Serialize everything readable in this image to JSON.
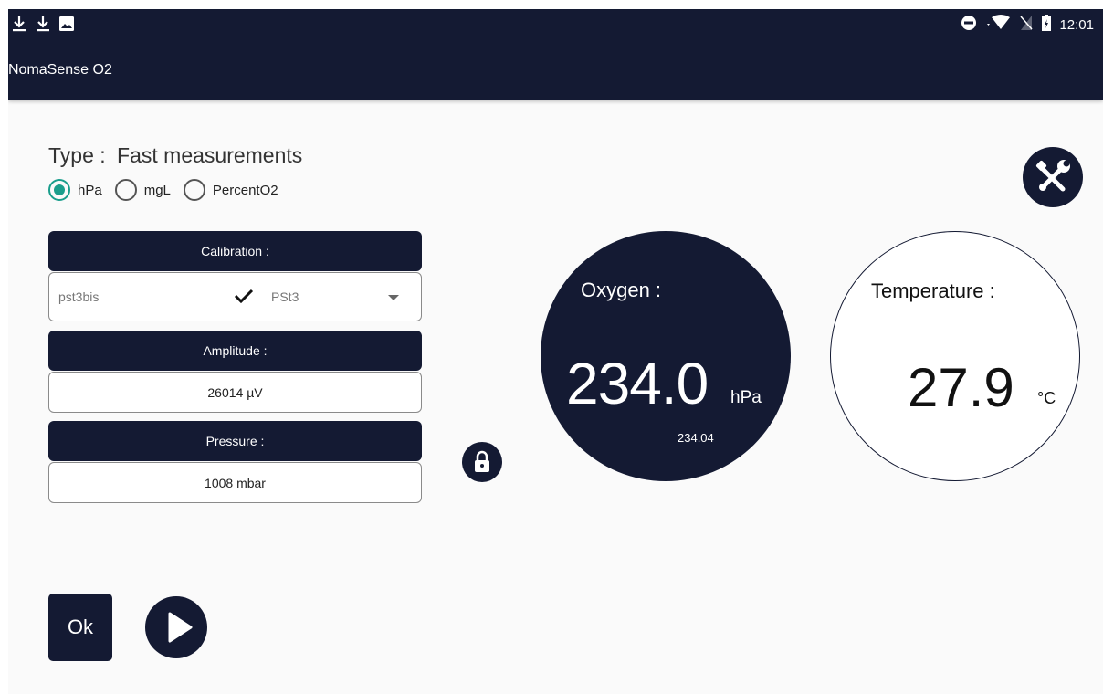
{
  "statusbar": {
    "time": "12:01",
    "left_icons": [
      "download-icon",
      "download-icon",
      "image-icon"
    ],
    "right_icons": [
      "do-not-disturb-icon",
      "wifi-icon",
      "no-sim-icon",
      "battery-icon"
    ]
  },
  "appbar": {
    "title": "NomaSense O2"
  },
  "type": {
    "label": "Type :",
    "value": "Fast measurements"
  },
  "units": {
    "options": [
      {
        "label": "hPa",
        "selected": true
      },
      {
        "label": "mgL",
        "selected": false
      },
      {
        "label": "PercentO2",
        "selected": false
      }
    ]
  },
  "calibration": {
    "header": "Calibration :",
    "sensor": "pst3bis",
    "selected": "PSt3"
  },
  "amplitude": {
    "header": "Amplitude :",
    "value": "26014 µV"
  },
  "pressure": {
    "header": "Pressure :",
    "value": "1008 mbar"
  },
  "oxygen": {
    "title": "Oxygen :",
    "value": "234.0",
    "unit": "hPa",
    "raw": "234.04"
  },
  "temperature": {
    "title": "Temperature :",
    "value": "27.9",
    "unit": "°C"
  },
  "actions": {
    "ok_label": "Ok"
  },
  "colors": {
    "primary": "#141a33",
    "accent": "#1a9e8c",
    "background": "#fafafa"
  }
}
